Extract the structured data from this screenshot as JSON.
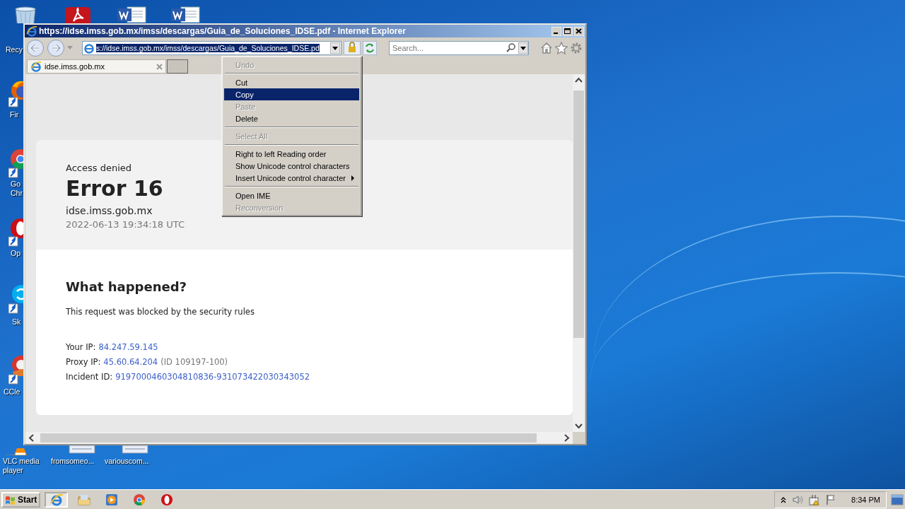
{
  "desktop_icons": [
    {
      "kind": "recycle-bin",
      "lines": [
        "Recy"
      ]
    },
    {
      "kind": "pdf"
    },
    {
      "kind": "word"
    },
    {
      "kind": "word"
    },
    {
      "kind": "firefox",
      "lines": [
        "Fir"
      ]
    },
    {
      "kind": "chrome",
      "lines": [
        "Go",
        "Chr"
      ]
    },
    {
      "kind": "opera",
      "lines": [
        "Op"
      ]
    },
    {
      "kind": "skype",
      "lines": [
        "Sk"
      ]
    },
    {
      "kind": "ccleaner",
      "lines": [
        "CCle"
      ]
    },
    {
      "kind": "vlc",
      "lines": [
        "VLC media",
        "player"
      ]
    },
    {
      "kind": "document",
      "lines": [
        "fromsomeo..."
      ]
    },
    {
      "kind": "document",
      "lines": [
        "variouscom..."
      ]
    }
  ],
  "window": {
    "title": "https://idse.imss.gob.mx/imss/descargas/Guia_de_Soluciones_IDSE.pdf - Internet Explorer",
    "address": "s://idse.imss.gob.mx/imss/descargas/Guia_de_Soluciones_IDSE.pd",
    "search_placeholder": "Search...",
    "tabs": [
      {
        "label": "idse.imss.gob.mx",
        "selected": true
      }
    ]
  },
  "page": {
    "subtitle": "Access denied",
    "title": "Error 16",
    "host": "idse.imss.gob.mx",
    "timestamp": "2022-06-13 19:34:18 UTC",
    "heading": "What happened?",
    "message": "This request was blocked by the security rules",
    "details": [
      {
        "label": "Your IP:",
        "value": "84.247.59.145"
      },
      {
        "label": "Proxy IP:",
        "value": "45.60.64.204",
        "note": "(ID 109197-100)"
      },
      {
        "label": "Incident ID:",
        "value": "9197000460304810836-931073422030343052"
      }
    ]
  },
  "context_menu": [
    {
      "kind": "item",
      "label": "Undo",
      "disabled": true,
      "selected": false
    },
    {
      "kind": "separator"
    },
    {
      "kind": "item",
      "label": "Cut",
      "disabled": false,
      "selected": false
    },
    {
      "kind": "item",
      "label": "Copy",
      "disabled": false,
      "selected": true
    },
    {
      "kind": "item",
      "label": "Paste",
      "disabled": true,
      "selected": false
    },
    {
      "kind": "item",
      "label": "Delete",
      "disabled": false,
      "selected": false
    },
    {
      "kind": "separator"
    },
    {
      "kind": "item",
      "label": "Select All",
      "disabled": true,
      "selected": false
    },
    {
      "kind": "separator"
    },
    {
      "kind": "item",
      "label": "Right to left Reading order",
      "disabled": false,
      "selected": false
    },
    {
      "kind": "item",
      "label": "Show Unicode control characters",
      "disabled": false,
      "selected": false
    },
    {
      "kind": "item",
      "label": "Insert Unicode control character",
      "disabled": false,
      "selected": false,
      "submenu": true
    },
    {
      "kind": "separator"
    },
    {
      "kind": "item",
      "label": "Open IME",
      "disabled": false,
      "selected": false
    },
    {
      "kind": "item",
      "label": "Reconversion",
      "disabled": true,
      "selected": false
    }
  ],
  "taskbar": {
    "start": "Start",
    "apps": [
      {
        "kind": "ie",
        "selected": true
      },
      {
        "kind": "explorer",
        "selected": false
      },
      {
        "kind": "media",
        "selected": false
      },
      {
        "kind": "chrome",
        "selected": false
      },
      {
        "kind": "opera",
        "selected": false
      }
    ],
    "clock": "8:34 PM"
  }
}
